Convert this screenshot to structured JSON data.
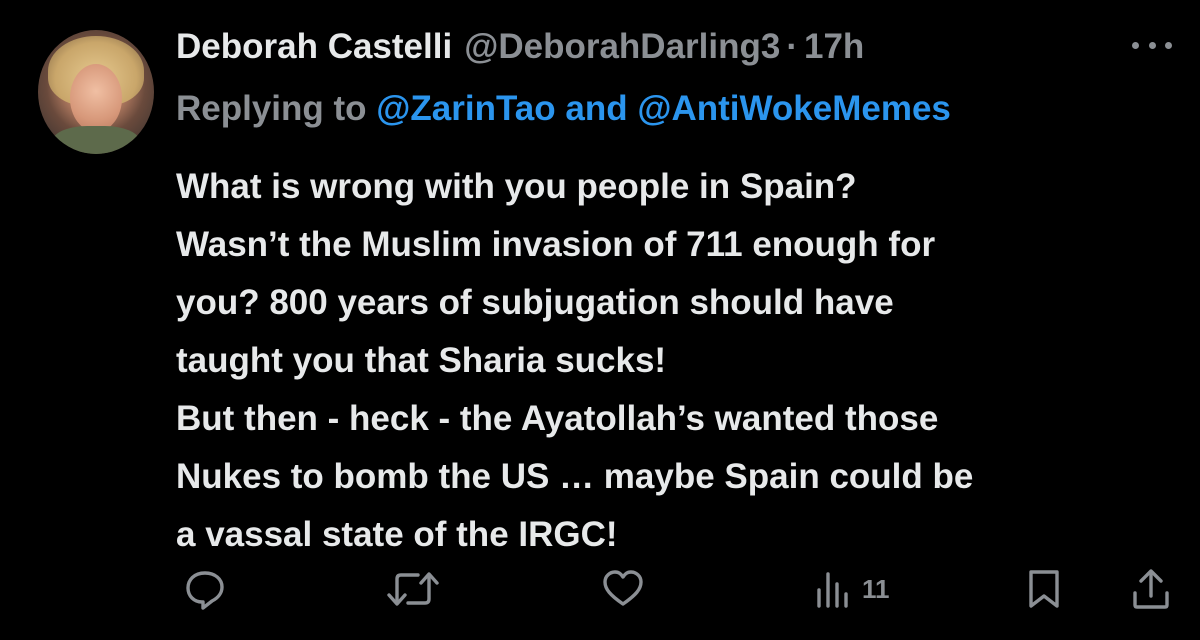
{
  "author": {
    "name": "Deborah Castelli",
    "handle": "@DeborahDarling3",
    "separator": "·",
    "time": "17h",
    "avatar_icon": "profile-photo"
  },
  "reply": {
    "prefix": "Replying to",
    "mention1": "@ZarinTao",
    "and": "and",
    "mention2": "@AntiWokeMemes"
  },
  "body_lines": [
    "What is wrong with you people in Spain?",
    "Wasn’t the Muslim invasion of 711 enough for",
    "you? 800 years of subjugation should have",
    "taught you that Sharia sucks!",
    "But then - heck - the Ayatollah’s wanted those",
    "Nukes to bomb the US … maybe Spain could be",
    "a vassal state of the IRGC!"
  ],
  "actions": {
    "reply_icon": "comment-icon",
    "retweet_icon": "retweet-icon",
    "like_icon": "heart-icon",
    "views_icon": "analytics-icon",
    "views_count": "11",
    "bookmark_icon": "bookmark-icon",
    "share_icon": "share-icon"
  },
  "colors": {
    "background": "#000000",
    "text": "#e7e9ea",
    "secondary": "#8b8f94",
    "link": "#2b95ee"
  }
}
